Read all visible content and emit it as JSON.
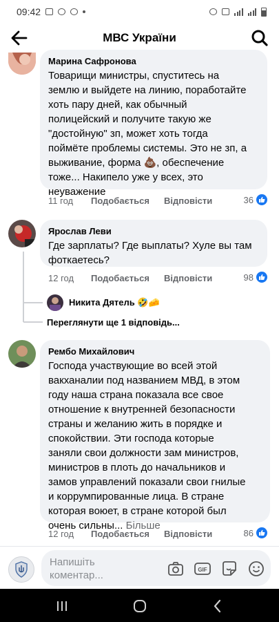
{
  "status": {
    "time": "09:42",
    "icons_left": [
      "image-icon",
      "whatsapp-icon",
      "viber-icon",
      "notification-dot"
    ],
    "icons_right": [
      "alarm-icon",
      "vibrate-icon",
      "signal-icon",
      "signal-icon",
      "battery-icon"
    ]
  },
  "header": {
    "title": "МВС України",
    "back_icon": "arrow-left-icon",
    "search_icon": "search-icon"
  },
  "comments": [
    {
      "author": "Марина Сафронова",
      "text_lines": [
        "Товарищи министры, спуститесь на",
        "землю и выйдете на линию, поработайте",
        "хоть пару дней, как обычный",
        "полицейский и получите такую же",
        "\"достойную\" зп, может хоть тогда",
        "поймёте проблемы системы. Это не зп, а",
        "выживание, форма 💩, обеспечение",
        "тоже... Накипело уже у всех, это",
        "неуважение"
      ],
      "time": "11 год",
      "like_label": "Подобається",
      "reply_label": "Відповісти",
      "reactions": "36"
    },
    {
      "author": "Ярослав Леви",
      "text_lines": [
        "Где зарплаты? Где выплаты? Хуле вы там",
        "фоткаетесь?"
      ],
      "time": "12 год",
      "like_label": "Подобається",
      "reply_label": "Відповісти",
      "reactions": "98",
      "reply_preview": {
        "name": "Никита Дятель 🤣🧀",
        "view_more": "Переглянути ще 1 відповідь..."
      }
    },
    {
      "author": "Рембо Михайлович",
      "text_lines": [
        "Господа участвующие во всей этой",
        "вакханалии под названием МВД, в этом",
        "году наша страна показала все свое",
        "отношение к внутренней безопасности",
        "страны и желанию жить в порядке и",
        "спокойствии. Эти господа которые",
        "заняли свои должности зам министров,",
        "министров в плоть до начальников и",
        "замов управлений показали свои гнилые",
        "и коррумпированные лица. В стране",
        "которая воюет, в стране которой был",
        "очень сильны... "
      ],
      "more_label": "Більше",
      "time": "12 год",
      "like_label": "Подобається",
      "reply_label": "Відповісти",
      "reactions": "86"
    }
  ],
  "composer": {
    "placeholder": "Напишіть коментар...",
    "tools": [
      "camera-icon",
      "gif-icon",
      "sticker-icon",
      "emoji-icon"
    ]
  },
  "nav": {
    "buttons": [
      "recent-apps-icon",
      "home-icon",
      "back-nav-icon"
    ]
  },
  "colors": {
    "accent": "#1877f2",
    "bubble": "#f0f2f5",
    "secondary_text": "#65676b"
  }
}
